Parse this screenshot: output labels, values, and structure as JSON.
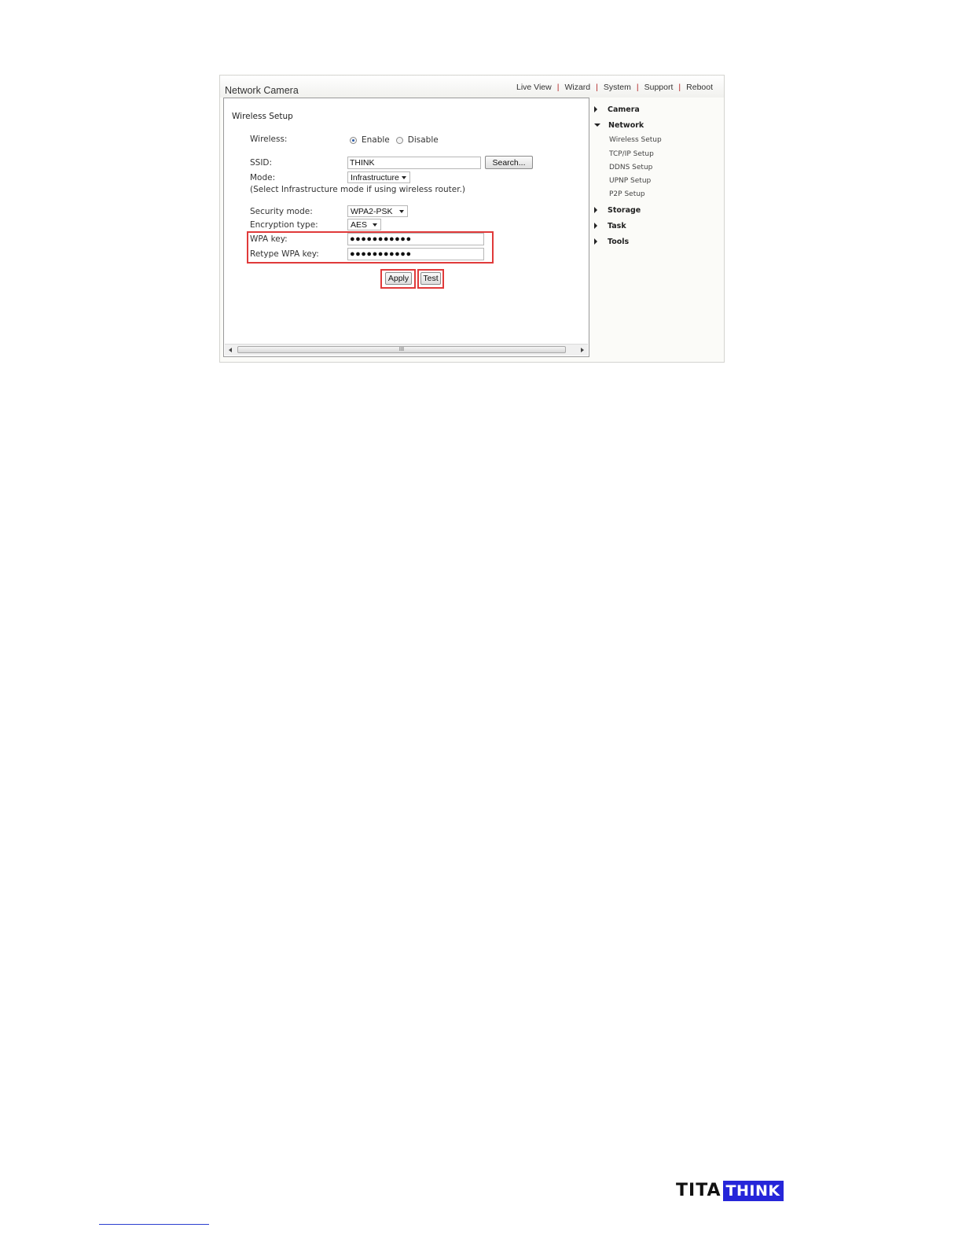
{
  "app": {
    "title": "Network Camera"
  },
  "topnav": {
    "items": [
      "Live View",
      "Wizard",
      "System",
      "Support",
      "Reboot"
    ]
  },
  "form": {
    "section_title": "Wireless Setup",
    "wireless_label": "Wireless:",
    "wireless_options": [
      "Enable",
      "Disable"
    ],
    "wireless_selected": "Enable",
    "ssid_label": "SSID:",
    "ssid_value": "THINK",
    "search_button": "Search...",
    "mode_label": "Mode:",
    "mode_value": "Infrastructure",
    "mode_hint": "(Select Infrastructure mode if using wireless router.)",
    "security_label": "Security mode:",
    "security_value": "WPA2-PSK",
    "encryption_label": "Encryption type:",
    "encryption_value": "AES",
    "wpa_key_label": "WPA key:",
    "wpa_key_value": "●●●●●●●●●●●",
    "retype_label": "Retype WPA key:",
    "retype_value": "●●●●●●●●●●●",
    "apply_button": "Apply",
    "test_button": "Test",
    "scroll_thumb_grip": "III",
    "highlight_color": "#e03a3a"
  },
  "sidebar": {
    "items": [
      {
        "label": "Camera",
        "expanded": false
      },
      {
        "label": "Network",
        "expanded": true
      },
      {
        "label": "Storage",
        "expanded": false
      },
      {
        "label": "Task",
        "expanded": false
      },
      {
        "label": "Tools",
        "expanded": false
      }
    ],
    "network_subitems": [
      "Wireless Setup",
      "TCP/IP Setup",
      "DDNS Setup",
      "UPNP Setup",
      "P2P Setup"
    ]
  },
  "footer": {
    "logo_left": "TITA",
    "logo_right": "THINK",
    "logo_color": "#2626d9"
  }
}
